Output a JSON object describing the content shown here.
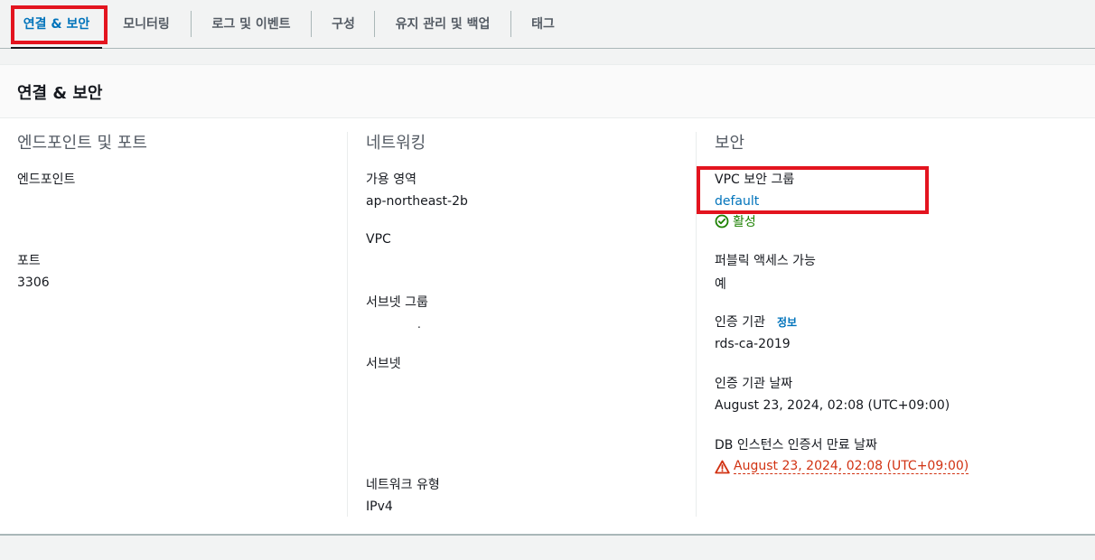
{
  "tabs": [
    {
      "label": "연결 & 보안",
      "active": true
    },
    {
      "label": "모니터링"
    },
    {
      "label": "로그 및 이벤트"
    },
    {
      "label": "구성"
    },
    {
      "label": "유지 관리 및 백업"
    },
    {
      "label": "태그"
    }
  ],
  "panel": {
    "title": "연결 & 보안",
    "endpoint_ports": {
      "title": "엔드포인트 및 포트",
      "endpoint_label": "엔드포인트",
      "endpoint_value": "",
      "port_label": "포트",
      "port_value": "3306"
    },
    "networking": {
      "title": "네트워킹",
      "az_label": "가용 영역",
      "az_value": "ap-northeast-2b",
      "vpc_label": "VPC",
      "vpc_value": "",
      "subnet_group_label": "서브넷 그룹",
      "subnet_group_value": ".",
      "subnets_label": "서브넷",
      "network_type_label": "네트워크 유형",
      "network_type_value": "IPv4"
    },
    "security": {
      "title": "보안",
      "sg_label": "VPC 보안 그룹",
      "sg_value": "default",
      "sg_status": "활성",
      "public_label": "퍼블릭 액세스 가능",
      "public_value": "예",
      "ca_label": "인증 기관",
      "ca_info": "정보",
      "ca_value": "rds-ca-2019",
      "ca_date_label": "인증 기관 날짜",
      "ca_date_value": "August 23, 2024, 02:08 (UTC+09:00)",
      "cert_expiry_label": "DB 인스턴스 인증서 만료 날짜",
      "cert_expiry_value": "August 23, 2024, 02:08 (UTC+09:00)"
    }
  },
  "colors": {
    "link": "#0073bb",
    "success": "#1d8102",
    "warning": "#d13212",
    "highlight": "#e3141f"
  }
}
